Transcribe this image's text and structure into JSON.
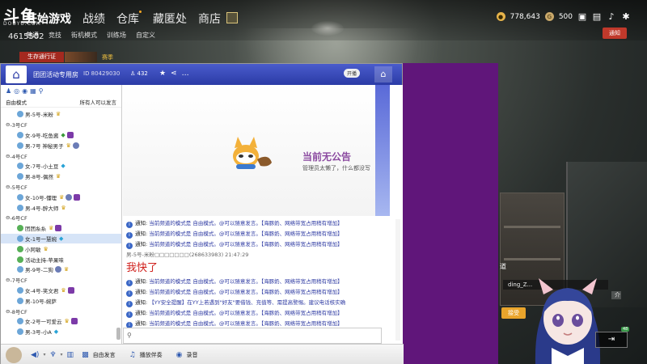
{
  "topbar": {
    "logo": "斗鱼",
    "logo_sub": "DOUYU.COM",
    "room_number": "4615502",
    "nav": [
      "开始游戏",
      "战绩",
      "仓库",
      "藏匿处",
      "商店"
    ],
    "subnav": [
      "普通",
      "竞技",
      "街机模式",
      "训练场",
      "自定义"
    ],
    "currency_1": "778,643",
    "currency_2": "500",
    "notice_button": "通知",
    "season_label": "生存通行证",
    "season_tag": "赛季"
  },
  "chat": {
    "channel_title": "团团活动专用房",
    "channel_id": "ID 80429030",
    "online_count": "432",
    "open_label": "开播",
    "mode_label": "自由模式",
    "mode_right": "所有人可以发言",
    "tree": [
      {
        "type": "u",
        "text": "男-5号-米粉",
        "icons": [
          "crown"
        ]
      },
      {
        "type": "ch",
        "text": "-3号CF"
      },
      {
        "type": "u",
        "text": "女-9号-吃鱼酱",
        "icons": [
          "leaf",
          "p"
        ]
      },
      {
        "type": "u",
        "text": "男-7号 神秘男子",
        "icons": [
          "crown",
          "v"
        ]
      },
      {
        "type": "ch",
        "text": "-4号CF"
      },
      {
        "type": "u",
        "text": "女-7号-小土豆",
        "icons": [
          "gem"
        ]
      },
      {
        "type": "u",
        "text": "男-8号-偶然",
        "icons": [
          "crown"
        ]
      },
      {
        "type": "ch",
        "text": "-5号CF"
      },
      {
        "type": "u",
        "text": "女-10号-懂理",
        "icons": [
          "crown",
          "v",
          "p"
        ]
      },
      {
        "type": "u",
        "text": "男-4号-醉大师",
        "icons": [
          "crown"
        ]
      },
      {
        "type": "ch",
        "text": "-6号CF"
      },
      {
        "type": "u",
        "text": "团团糸糸",
        "icons": [
          "crown",
          "p"
        ],
        "green": true
      },
      {
        "type": "u",
        "text": "女-1号一慧婉",
        "icons": [
          "gem"
        ],
        "sel": true
      },
      {
        "type": "u",
        "text": "小阿敏",
        "icons": [
          "crown"
        ],
        "green": true
      },
      {
        "type": "u",
        "text": "活动主持-苹果味",
        "icons": [],
        "green": true
      },
      {
        "type": "u",
        "text": "男-9号-二狗",
        "icons": [
          "v",
          "crown"
        ]
      },
      {
        "type": "ch",
        "text": "-7号CF"
      },
      {
        "type": "u",
        "text": "女-4号-笑文君",
        "icons": [
          "crown",
          "p"
        ]
      },
      {
        "type": "u",
        "text": "男-10号-婉萨",
        "icons": []
      },
      {
        "type": "ch",
        "text": "-8号CF"
      },
      {
        "type": "u",
        "text": "女-2号一可爱云",
        "icons": [
          "crown",
          "p"
        ]
      },
      {
        "type": "u",
        "text": "男-3号-小A",
        "icons": [
          "gem"
        ]
      }
    ],
    "notice_title": "当前无公告",
    "notice_sub": "管理员太懒了，什么都没写",
    "messages": [
      {
        "kind": "notice",
        "label": "通知:",
        "text": "当前频道的模式是 自由模式。@可以随意发言。【海豚奶、网络带宽占用稍有增加】"
      },
      {
        "kind": "notice",
        "label": "通知:",
        "text": "当前频道的模式是 自由模式。@可以随意发言。【海豚奶、网络带宽占用稍有增加】"
      },
      {
        "kind": "notice",
        "label": "通知:",
        "text": "当前频道的模式是 自由模式。@可以随意发言。【海豚奶、网络带宽占用稍有增加】"
      },
      {
        "kind": "user",
        "text": "男-5号-米粉□□□□□□□(268633983) 21:47:29"
      },
      {
        "kind": "big",
        "text": "我快了"
      },
      {
        "kind": "notice",
        "label": "通知:",
        "text": "当前频道的模式是 自由模式。@可以随意发言。【海豚奶、网络带宽占用稍有增加】"
      },
      {
        "kind": "notice",
        "label": "通知:",
        "text": "当前频道的模式是 自由模式。@可以随意发言。【海豚奶、网络带宽占用稍有增加】"
      },
      {
        "kind": "notice",
        "label": "通知:",
        "text": "【YY安全提醒】在YY上若遇到\"好友\"要借钱、充值等、需提高警惕。建议电话核实确"
      },
      {
        "kind": "notice",
        "label": "通知:",
        "text": "当前频道的模式是 自由模式。@可以随意发言。【海豚奶、网络带宽占用稍有增加】"
      },
      {
        "kind": "notice",
        "label": "通知:",
        "text": "当前频道的模式是 自由模式。@可以随意发言。【海豚奶、网络带宽占用稍有增加】"
      },
      {
        "kind": "notice",
        "label": "通知:",
        "text": "当前频道的模式是 自由模式。@可以随意发言。【海豚奶、网络带宽占用稍有增加】认好友备"
      }
    ],
    "bottom": {
      "free_talk": "自由发言",
      "play_music": "播放伴奏",
      "record": "录音"
    }
  },
  "stream": {
    "label": "道",
    "name": "ding_Z...",
    "accept": "接受",
    "intro": "介",
    "count": "48"
  },
  "colors": {
    "purple_panel": "#60167a",
    "yy_header": "#2b3ba6",
    "notice_red": "#c0392b"
  }
}
